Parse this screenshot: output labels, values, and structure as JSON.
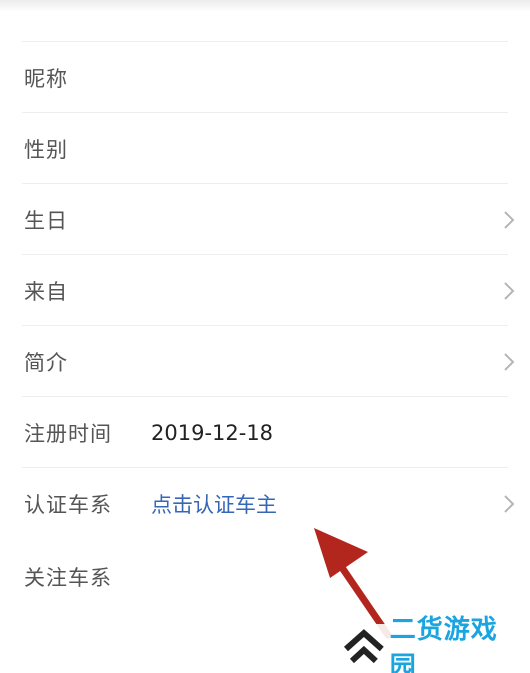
{
  "rows": [
    {
      "label": "昵称",
      "value": "",
      "has_chevron": false
    },
    {
      "label": "性别",
      "value": "",
      "has_chevron": false
    },
    {
      "label": "生日",
      "value": "",
      "has_chevron": true
    },
    {
      "label": "来自",
      "value": "",
      "has_chevron": true
    },
    {
      "label": "简介",
      "value": "",
      "has_chevron": true
    },
    {
      "label": "注册时间",
      "value": "2019-12-18",
      "has_chevron": false
    },
    {
      "label": "认证车系",
      "value": "点击认证车主",
      "has_chevron": true
    },
    {
      "label": "关注车系",
      "value": "",
      "has_chevron": false
    }
  ],
  "watermark": {
    "text": "二货游戏园"
  },
  "colors": {
    "label": "#555555",
    "value": "#222222",
    "link": "#3566b8",
    "divider": "#eeeeee",
    "arrow": "#b3261e",
    "watermark": "#1aa4e0"
  },
  "icons": {
    "chevron": "chevron-right-icon",
    "annotation": "red-arrow-icon",
    "watermark_logo": "double-chevron-up-icon"
  }
}
